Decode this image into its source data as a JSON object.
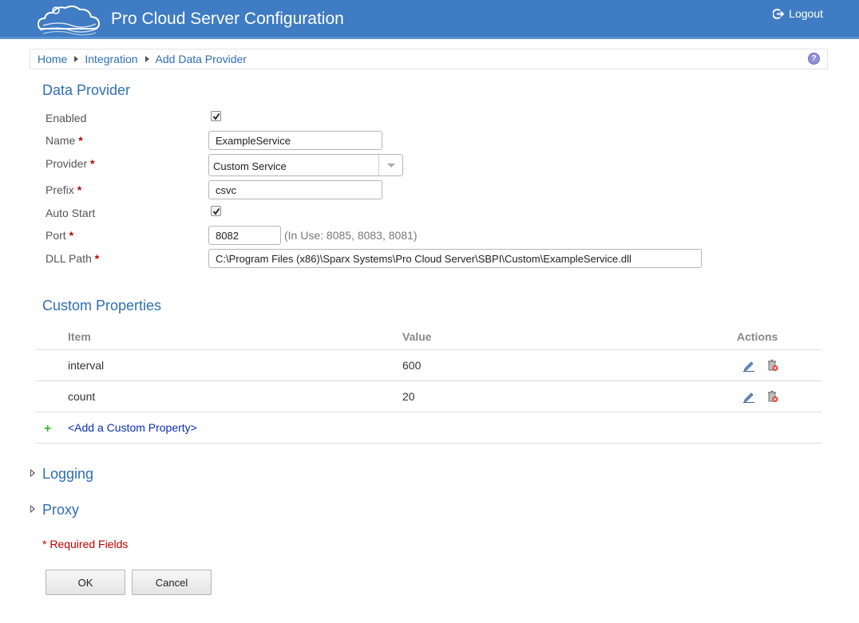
{
  "header": {
    "title": "Pro Cloud Server Configuration",
    "logout_label": "Logout"
  },
  "breadcrumb": [
    "Home",
    "Integration",
    "Add Data Provider"
  ],
  "data_provider": {
    "section_title": "Data Provider",
    "enabled": {
      "label": "Enabled",
      "checked": true
    },
    "name": {
      "label": "Name",
      "required_mark": "*",
      "value": "ExampleService"
    },
    "provider": {
      "label": "Provider",
      "required_mark": "*",
      "value": "Custom Service"
    },
    "prefix": {
      "label": "Prefix",
      "required_mark": "*",
      "value": "csvc"
    },
    "auto_start": {
      "label": "Auto Start",
      "checked": true
    },
    "port": {
      "label": "Port",
      "required_mark": "*",
      "value": "8082",
      "hint": "(In Use: 8085, 8083, 8081)"
    },
    "dll_path": {
      "label": "DLL Path",
      "required_mark": "*",
      "value": "C:\\Program Files (x86)\\Sparx Systems\\Pro Cloud Server\\SBPI\\Custom\\ExampleService.dll"
    }
  },
  "custom_properties": {
    "section_title": "Custom Properties",
    "columns": [
      "Item",
      "Value",
      "Actions"
    ],
    "rows": [
      {
        "item": "interval",
        "value": "600"
      },
      {
        "item": "count",
        "value": "20"
      }
    ],
    "add_label": "<Add a Custom Property>",
    "add_symbol": "+"
  },
  "collapsibles": {
    "logging": "Logging",
    "proxy": "Proxy"
  },
  "required_note": "* Required Fields",
  "buttons": {
    "ok": "OK",
    "cancel": "Cancel"
  },
  "colors": {
    "header_bg": "#3f7cc3",
    "link": "#2f6fb6",
    "required": "#c00000"
  }
}
